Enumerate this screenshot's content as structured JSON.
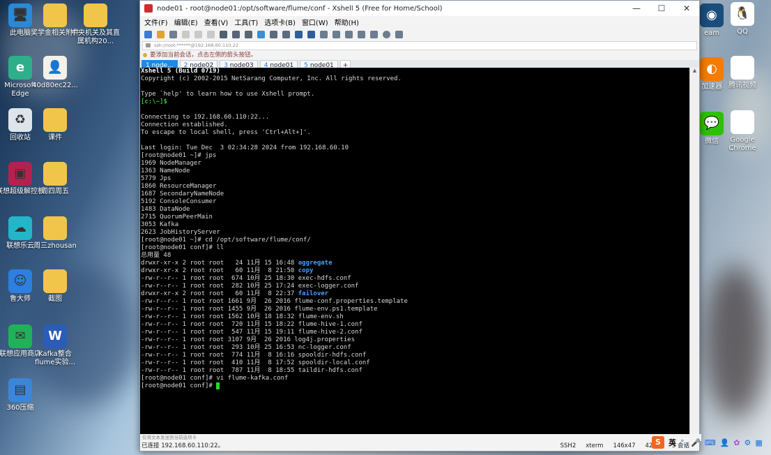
{
  "desktop_icons": [
    {
      "label": "此电脑",
      "icon": "computer-icon",
      "color": "#2a89d6"
    },
    {
      "label": "奖学金相关附件",
      "icon": "folder-icon",
      "color": "#f1c54a"
    },
    {
      "label": "中央机关及其直属机构20...",
      "icon": "folder-icon",
      "color": "#f1c54a"
    },
    {
      "label": "Microsoft Edge",
      "icon": "edge-icon",
      "color": "#2fae8b"
    },
    {
      "label": "40d80ec22...",
      "icon": "photo-icon",
      "color": "#f4f0ea"
    },
    {
      "label": "回收站",
      "icon": "recycle-bin-icon",
      "color": "#dde4ea"
    },
    {
      "label": "课件",
      "icon": "folder-icon",
      "color": "#f1c54a"
    },
    {
      "label": "联想超级解控板",
      "icon": "lenovo-panel-icon",
      "color": "#b4214e"
    },
    {
      "label": "周四周五",
      "icon": "folder-icon",
      "color": "#f1c54a"
    },
    {
      "label": "联想乐云",
      "icon": "cloud-icon",
      "color": "#24b5c9"
    },
    {
      "label": "周三zhousan",
      "icon": "folder-icon",
      "color": "#f1c54a"
    },
    {
      "label": "鲁大师",
      "icon": "ludashi-icon",
      "color": "#2d7fe0"
    },
    {
      "label": "截图",
      "icon": "folder-icon",
      "color": "#f1c54a"
    },
    {
      "label": "联想应用商店",
      "icon": "app-store-icon",
      "color": "#20b15a"
    },
    {
      "label": "Kafka整合flume实验...",
      "icon": "word-doc-icon",
      "color": "#2b5cb8"
    },
    {
      "label": "360压缩",
      "icon": "zip-icon",
      "color": "#3b86d8"
    }
  ],
  "right_icons": [
    {
      "label": "QQ",
      "icon": "qq-icon",
      "color": "#ffffff"
    },
    {
      "label": "eam",
      "icon": "steam-icon",
      "color": "#1b4d7a"
    },
    {
      "label": "腾讯视频",
      "icon": "tencent-video-icon",
      "color": "#ffffff"
    },
    {
      "label": "加速器",
      "icon": "accelerator-icon",
      "color": "#f57c00"
    },
    {
      "label": "Google Chrome",
      "icon": "chrome-icon",
      "color": "#ffffff"
    },
    {
      "label": "微信",
      "icon": "wechat-icon",
      "color": "#2dc100"
    }
  ],
  "window": {
    "title": "node01 - root@node01:/opt/software/flume/conf - Xshell 5 (Free for Home/School)",
    "minimize": "—",
    "maximize": "☐",
    "close": "✕"
  },
  "menu": [
    "文件(F)",
    "编辑(E)",
    "查看(V)",
    "工具(T)",
    "选项卡(B)",
    "窗口(W)",
    "帮助(H)"
  ],
  "address": "ssh://root:******@192.168.60.110:22",
  "hint": "要添加当前会话，点击左侧的箭头按钮。",
  "tabs": [
    {
      "num": "1",
      "name": "node..."
    },
    {
      "num": "2",
      "name": "node02"
    },
    {
      "num": "3",
      "name": "node03"
    },
    {
      "num": "4",
      "name": "node01"
    },
    {
      "num": "5",
      "name": "node01"
    },
    {
      "num": "",
      "name": "+"
    }
  ],
  "terminal_lines": [
    "Xshell 5 (Build 0719)",
    "Copyright (c) 2002-2015 NetSarang Computer, Inc. All rights reserved.",
    "",
    "Type `help' to learn how to use Xshell prompt.",
    "[c:\\~]$",
    "",
    "Connecting to 192.168.60.110:22...",
    "Connection established.",
    "To escape to local shell, press 'Ctrl+Alt+]'.",
    "",
    "Last login: Tue Dec  3 02:34:28 2024 from 192.168.60.10",
    "[root@node01 ~]# jps",
    "1969 NodeManager",
    "1363 NameNode",
    "5779 Jps",
    "1860 ResourceManager",
    "1687 SecondaryNameNode",
    "5192 ConsoleConsumer",
    "1483 DataNode",
    "2715 QuorumPeerMain",
    "3053 Kafka",
    "2623 JobHistoryServer",
    "[root@node01 ~]# cd /opt/software/flume/conf/",
    "[root@node01 conf]# ll",
    "总用量 48"
  ],
  "listing": [
    {
      "perm": "drwxr-xr-x 2 root root   24 11月 15 16:48 ",
      "name": "aggregate",
      "dir": true
    },
    {
      "perm": "drwxr-xr-x 2 root root   60 11月  8 21:50 ",
      "name": "copy",
      "dir": true
    },
    {
      "perm": "-rw-r--r-- 1 root root  674 10月 25 18:30 ",
      "name": "exec-hdfs.conf",
      "dir": false
    },
    {
      "perm": "-rw-r--r-- 1 root root  282 10月 25 17:24 ",
      "name": "exec-logger.conf",
      "dir": false
    },
    {
      "perm": "drwxr-xr-x 2 root root   60 11月  8 22:37 ",
      "name": "failover",
      "dir": true
    },
    {
      "perm": "-rw-r--r-- 1 root root 1661 9月  26 2016 ",
      "name": "flume-conf.properties.template",
      "dir": false
    },
    {
      "perm": "-rw-r--r-- 1 root root 1455 9月  26 2016 ",
      "name": "flume-env.ps1.template",
      "dir": false
    },
    {
      "perm": "-rw-r--r-- 1 root root 1562 10月 18 18:32 ",
      "name": "flume-env.sh",
      "dir": false
    },
    {
      "perm": "-rw-r--r-- 1 root root  720 11月 15 18:22 ",
      "name": "flume-hive-1.conf",
      "dir": false
    },
    {
      "perm": "-rw-r--r-- 1 root root  547 11月 15 19:11 ",
      "name": "flume-hive-2.conf",
      "dir": false
    },
    {
      "perm": "-rw-r--r-- 1 root root 3107 9月  26 2016 ",
      "name": "log4j.properties",
      "dir": false
    },
    {
      "perm": "-rw-r--r-- 1 root root  293 10月 25 16:53 ",
      "name": "nc-logger.conf",
      "dir": false
    },
    {
      "perm": "-rw-r--r-- 1 root root  774 11月  8 16:16 ",
      "name": "spooldir-hdfs.conf",
      "dir": false
    },
    {
      "perm": "-rw-r--r-- 1 root root  410 11月  8 17:52 ",
      "name": "spooldir-local.conf",
      "dir": false
    },
    {
      "perm": "-rw-r--r-- 1 root root  787 11月  8 18:55 ",
      "name": "taildir-hdfs.conf",
      "dir": false
    }
  ],
  "tail_lines": [
    "[root@node01 conf]# vi flume-kafka.conf",
    "[root@node01 conf]# "
  ],
  "sendbar": "仅将文本发送到当前选项卡",
  "status": {
    "connection": "已连接 192.168.60.110:22。",
    "protocol": "SSH2",
    "term": "xterm",
    "size": "146x47",
    "cursor": "42,21",
    "sessions": "5 会话"
  },
  "tray": {
    "ime": "英"
  }
}
